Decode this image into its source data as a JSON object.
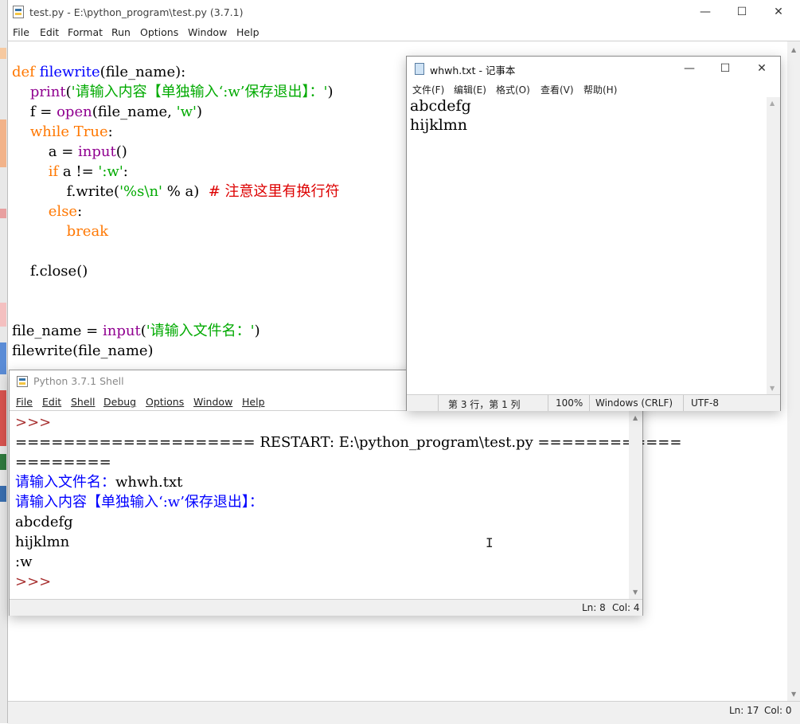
{
  "editor": {
    "title": "test.py - E:\\python_program\\test.py (3.7.1)",
    "menu": [
      "File",
      "Edit",
      "Format",
      "Run",
      "Options",
      "Window",
      "Help"
    ],
    "lines": [
      [
        {
          "t": "def ",
          "c": "kw"
        },
        {
          "t": "filewrite",
          "c": "fn"
        },
        {
          "t": "(file_name):",
          "c": "df"
        }
      ],
      [
        {
          "t": "    ",
          "c": "df"
        },
        {
          "t": "print",
          "c": "bi"
        },
        {
          "t": "(",
          "c": "df"
        },
        {
          "t": "'请输入内容【单独输入‘:w’保存退出】：'",
          "c": "st"
        },
        {
          "t": ")",
          "c": "df"
        }
      ],
      [
        {
          "t": "    f = ",
          "c": "df"
        },
        {
          "t": "open",
          "c": "bi"
        },
        {
          "t": "(file_name, ",
          "c": "df"
        },
        {
          "t": "'w'",
          "c": "st"
        },
        {
          "t": ")",
          "c": "df"
        }
      ],
      [
        {
          "t": "    ",
          "c": "df"
        },
        {
          "t": "while",
          "c": "kw"
        },
        {
          "t": " ",
          "c": "df"
        },
        {
          "t": "True",
          "c": "kw"
        },
        {
          "t": ":",
          "c": "df"
        }
      ],
      [
        {
          "t": "        a = ",
          "c": "df"
        },
        {
          "t": "input",
          "c": "bi"
        },
        {
          "t": "()",
          "c": "df"
        }
      ],
      [
        {
          "t": "        ",
          "c": "df"
        },
        {
          "t": "if",
          "c": "kw"
        },
        {
          "t": " a != ",
          "c": "df"
        },
        {
          "t": "':w'",
          "c": "st"
        },
        {
          "t": ":",
          "c": "df"
        }
      ],
      [
        {
          "t": "            f.write(",
          "c": "df"
        },
        {
          "t": "'%s\\n'",
          "c": "st"
        },
        {
          "t": " % a)  ",
          "c": "df"
        },
        {
          "t": "# 注意这里有换行符",
          "c": "cm"
        }
      ],
      [
        {
          "t": "        ",
          "c": "df"
        },
        {
          "t": "else",
          "c": "kw"
        },
        {
          "t": ":",
          "c": "df"
        }
      ],
      [
        {
          "t": "            ",
          "c": "df"
        },
        {
          "t": "break",
          "c": "kw"
        }
      ],
      [],
      [
        {
          "t": "    f.close()",
          "c": "df"
        }
      ],
      [],
      [],
      [
        {
          "t": "file_name = ",
          "c": "df"
        },
        {
          "t": "input",
          "c": "bi"
        },
        {
          "t": "(",
          "c": "df"
        },
        {
          "t": "'请输入文件名：'",
          "c": "st"
        },
        {
          "t": ")",
          "c": "df"
        }
      ],
      [
        {
          "t": "filewrite(file_name)",
          "c": "df"
        }
      ]
    ],
    "status": {
      "ln": "Ln: 17",
      "col": "Col: 0"
    }
  },
  "notepad": {
    "title": "whwh.txt - 记事本",
    "menu": [
      "文件(F)",
      "编辑(E)",
      "格式(O)",
      "查看(V)",
      "帮助(H)"
    ],
    "lines": [
      "abcdefg",
      "hijklmn"
    ],
    "status": {
      "pos": "第 3 行，第 1 列",
      "zoom": "100%",
      "eol": "Windows (CRLF)",
      "enc": "UTF-8"
    }
  },
  "shell": {
    "title": "Python 3.7.1 Shell",
    "menu": [
      "File",
      "Edit",
      "Shell",
      "Debug",
      "Options",
      "Window",
      "Help"
    ],
    "lines": [
      [
        {
          "t": ">>> ",
          "c": "pr"
        }
      ],
      [
        {
          "t": "==================== RESTART: E:\\python_program\\test.py ============",
          "c": "df"
        }
      ],
      [
        {
          "t": "========",
          "c": "df"
        }
      ],
      [
        {
          "t": "请输入文件名：",
          "c": "ou"
        },
        {
          "t": "whwh.txt",
          "c": "df"
        }
      ],
      [
        {
          "t": "请输入内容【单独输入‘:w’保存退出】：",
          "c": "ou"
        }
      ],
      [
        {
          "t": "abcdefg",
          "c": "df"
        }
      ],
      [
        {
          "t": "hijklmn",
          "c": "df"
        }
      ],
      [
        {
          "t": ":w",
          "c": "df"
        }
      ],
      [
        {
          "t": ">>> ",
          "c": "pr"
        }
      ]
    ],
    "status": {
      "ln": "Ln: 8",
      "col": "Col: 4"
    }
  },
  "controls": {
    "minimize": "—",
    "maximize": "☐",
    "close": "✕"
  }
}
